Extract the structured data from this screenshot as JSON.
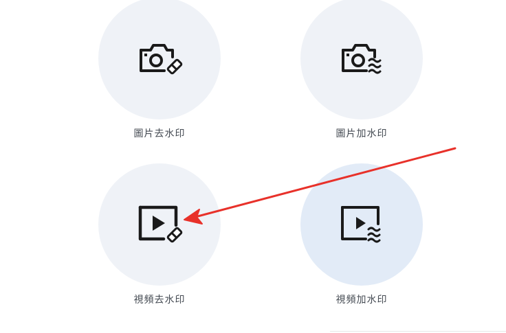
{
  "tools": [
    {
      "label": "圖片去水印",
      "icon": "photo-eraser-icon"
    },
    {
      "label": "圖片加水印",
      "icon": "photo-watermark-icon"
    },
    {
      "label": "視頻去水印",
      "icon": "video-eraser-icon"
    },
    {
      "label": "視頻加水印",
      "icon": "video-watermark-icon"
    }
  ],
  "colors": {
    "circle_bg": "#eff2f7",
    "circle_active_bg": "#e2ebf7",
    "icon_stroke": "#1a1a1a",
    "annotation_arrow": "#e8312a"
  }
}
